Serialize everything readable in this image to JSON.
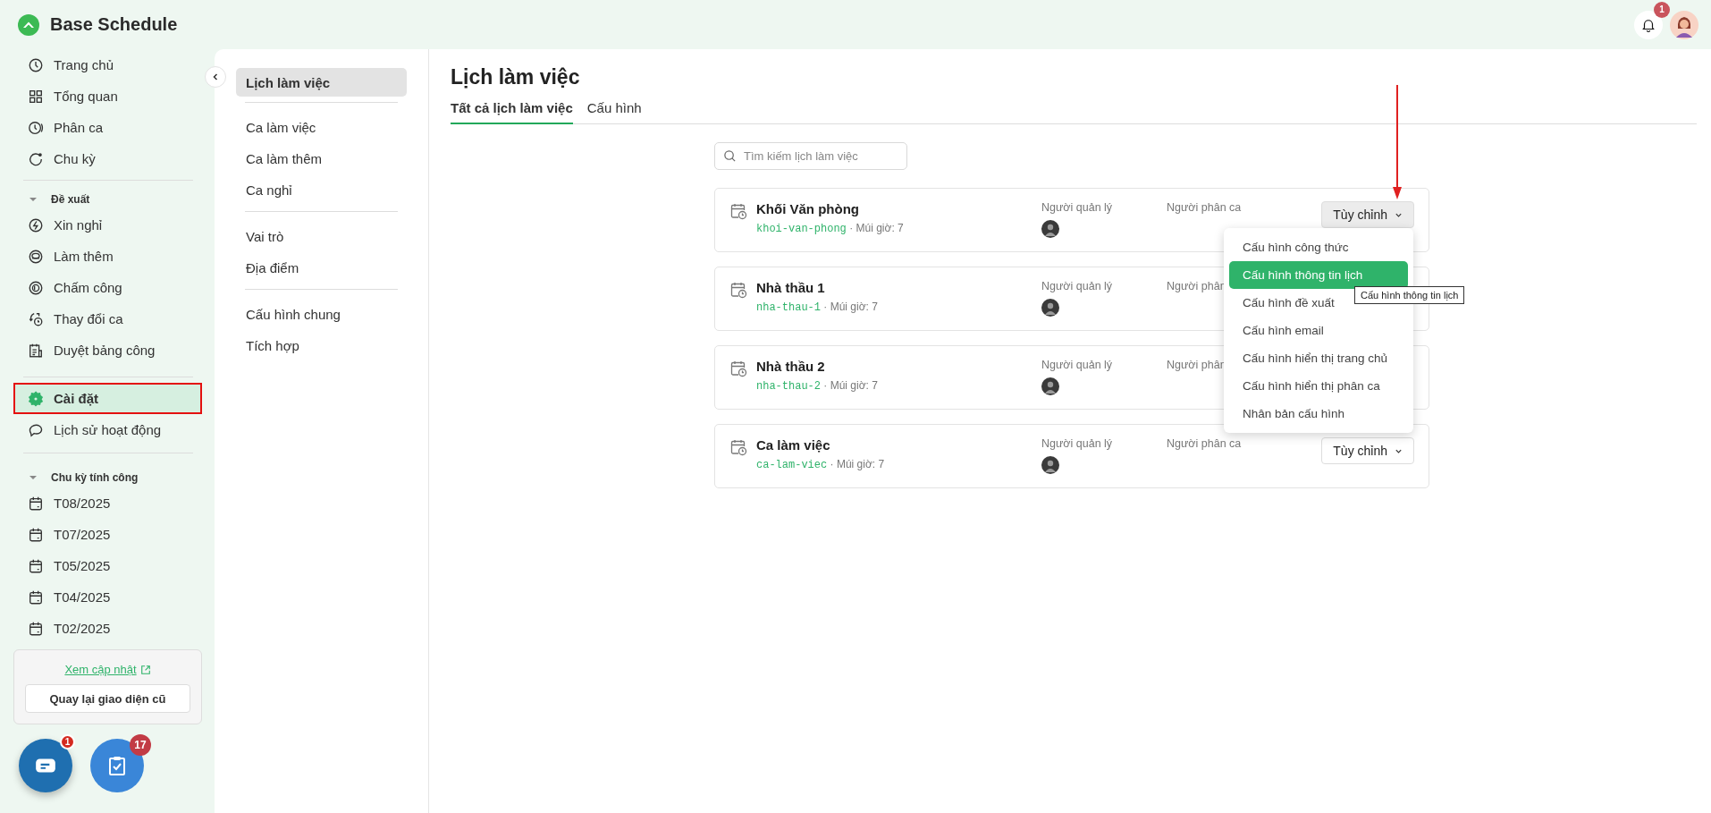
{
  "app": {
    "title": "Base Schedule",
    "notification_count": "1"
  },
  "sidebar": {
    "groups": [
      {
        "items": [
          {
            "label": "Trang chủ",
            "selected": false,
            "annotated": false
          },
          {
            "label": "Tổng quan",
            "selected": false,
            "annotated": false
          },
          {
            "label": "Phân ca",
            "selected": false,
            "annotated": false
          },
          {
            "label": "Chu kỳ",
            "selected": false,
            "annotated": false
          }
        ]
      },
      {
        "title": "Đề xuất",
        "expanded": true,
        "items": [
          {
            "label": "Xin nghỉ",
            "selected": false,
            "annotated": false
          },
          {
            "label": "Làm thêm",
            "selected": false,
            "annotated": false
          },
          {
            "label": "Chấm công",
            "selected": false,
            "annotated": false
          },
          {
            "label": "Thay đổi ca",
            "selected": false,
            "annotated": false
          },
          {
            "label": "Duyệt bảng công",
            "selected": false,
            "annotated": false
          }
        ]
      },
      {
        "items": [
          {
            "label": "Cài đặt",
            "selected": true,
            "annotated": true
          },
          {
            "label": "Lịch sử hoạt động",
            "selected": false,
            "annotated": false
          }
        ]
      },
      {
        "title": "Chu kỳ tính công",
        "expanded": true,
        "items": [
          {
            "label": "T08/2025",
            "selected": false,
            "annotated": false
          },
          {
            "label": "T07/2025",
            "selected": false,
            "annotated": false
          },
          {
            "label": "T05/2025",
            "selected": false,
            "annotated": false
          },
          {
            "label": "T04/2025",
            "selected": false,
            "annotated": false
          },
          {
            "label": "T02/2025",
            "selected": false,
            "annotated": false
          }
        ]
      }
    ],
    "update_box": {
      "link": "Xem cập nhật",
      "button": "Quay lại giao diện cũ"
    },
    "fabs": [
      {
        "badge": "1"
      },
      {
        "badge": "17"
      }
    ]
  },
  "settings_menu": {
    "groups": [
      {
        "items": [
          {
            "label": "Lịch làm việc",
            "selected": true
          }
        ]
      },
      {
        "items": [
          {
            "label": "Ca làm việc",
            "selected": false
          },
          {
            "label": "Ca làm thêm",
            "selected": false
          },
          {
            "label": "Ca nghỉ",
            "selected": false
          }
        ]
      },
      {
        "items": [
          {
            "label": "Vai trò",
            "selected": false
          },
          {
            "label": "Địa điểm",
            "selected": false
          }
        ]
      },
      {
        "items": [
          {
            "label": "Cấu hình chung",
            "selected": false
          },
          {
            "label": "Tích hợp",
            "selected": false
          }
        ]
      }
    ]
  },
  "main": {
    "title": "Lịch làm việc",
    "tabs": [
      {
        "label": "Tất cả lịch làm việc",
        "selected": true
      },
      {
        "label": "Cấu hình",
        "selected": false
      }
    ],
    "search": {
      "placeholder": "Tìm kiếm lịch làm việc"
    },
    "schedules": [
      {
        "name": "Khối Văn phòng",
        "code": "khoi-van-phong",
        "timezone": "· Múi giờ: 7",
        "manager_label": "Người quản lý",
        "scheduler_label": "Người phân ca",
        "button": {
          "label": "Tùy chỉnh",
          "active": true
        }
      },
      {
        "name": "Nhà thầu 1",
        "code": "nha-thau-1",
        "timezone": "· Múi giờ: 7",
        "manager_label": "Người quản lý",
        "scheduler_label": "Người phân"
      },
      {
        "name": "Nhà thầu 2",
        "code": "nha-thau-2",
        "timezone": "· Múi giờ: 7",
        "manager_label": "Người quản lý",
        "scheduler_label": "Người phân"
      },
      {
        "name": "Ca làm việc",
        "code": "ca-lam-viec",
        "timezone": "· Múi giờ: 7",
        "manager_label": "Người quản lý",
        "scheduler_label": "Người phân ca",
        "button": {
          "label": "Tùy chỉnh",
          "active": false
        }
      }
    ],
    "dropdown": {
      "items": [
        {
          "label": "Cấu hình công thức",
          "selected": false
        },
        {
          "label": "Cấu hình thông tin lịch",
          "selected": true
        },
        {
          "label": "Cấu hình đề xuất",
          "selected": false
        },
        {
          "label": "Cấu hình email",
          "selected": false
        },
        {
          "label": "Cấu hình hiển thị trang chủ",
          "selected": false
        },
        {
          "label": "Cấu hình hiển thị phân ca",
          "selected": false
        },
        {
          "label": "Nhân bản cấu hình",
          "selected": false
        }
      ],
      "tooltip": "Cấu hình thông tin lịch"
    }
  }
}
